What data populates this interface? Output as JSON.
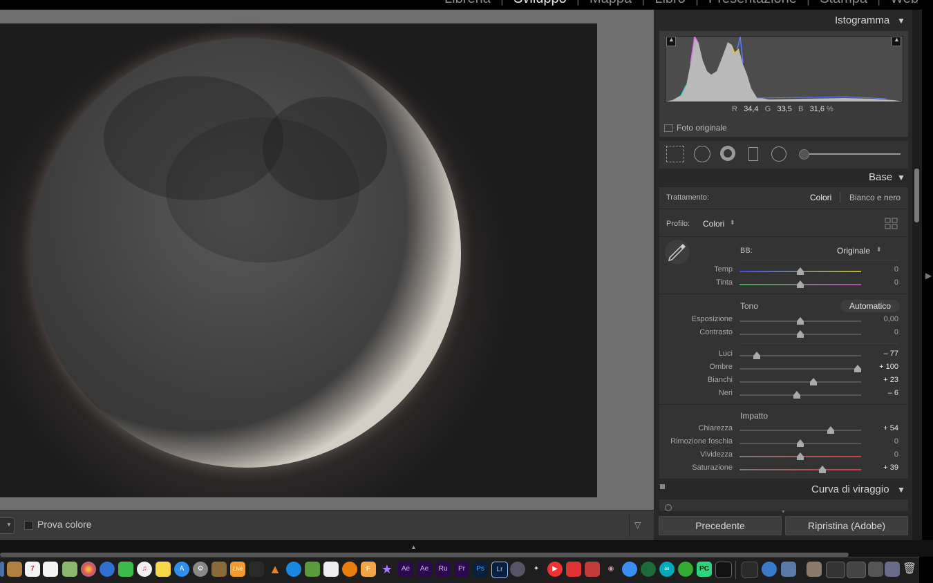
{
  "modules": {
    "libreria": "Libreria",
    "sviluppo": "Sviluppo",
    "mappa": "Mappa",
    "libro": "Libro",
    "presentazione": "Presentazione",
    "stampa": "Stampa",
    "web": "Web",
    "sep": "|"
  },
  "toolbar": {
    "proof_label": "Prova colore"
  },
  "histogram": {
    "title": "Istogramma",
    "r_label": "R",
    "r_value": "34,4",
    "g_label": "G",
    "g_value": "33,5",
    "b_label": "B",
    "b_value": "31,6",
    "percent": "%",
    "original_photo_label": "Foto originale"
  },
  "base": {
    "title": "Base",
    "treatment_label": "Trattamento:",
    "treatment_color": "Colori",
    "treatment_bw": "Bianco e nero",
    "profile_label": "Profilo:",
    "profile_value": "Colori",
    "wb_label": "BB:",
    "wb_value": "Originale",
    "tone_label": "Tono",
    "auto_label": "Automatico",
    "impact_label": "Impatto",
    "sliders": [
      {
        "label": "Temp",
        "value": "0",
        "position": 0.5
      },
      {
        "label": "Tinta",
        "value": "0",
        "position": 0.5
      },
      {
        "label": "Esposizione",
        "value": "0,00",
        "position": 0.5
      },
      {
        "label": "Contrasto",
        "value": "0",
        "position": 0.5
      },
      {
        "label": "Luci",
        "value": "– 77",
        "position": 0.14
      },
      {
        "label": "Ombre",
        "value": "+ 100",
        "position": 0.97
      },
      {
        "label": "Bianchi",
        "value": "+ 23",
        "position": 0.61
      },
      {
        "label": "Neri",
        "value": "– 6",
        "position": 0.47
      },
      {
        "label": "Chiarezza",
        "value": "+ 54",
        "position": 0.75
      },
      {
        "label": "Rimozione foschia",
        "value": "0",
        "position": 0.5
      },
      {
        "label": "Vividezza",
        "value": "0",
        "position": 0.5
      },
      {
        "label": "Saturazione",
        "value": "+ 39",
        "position": 0.68
      }
    ]
  },
  "tone_curve": {
    "title": "Curva di viraggio"
  },
  "buttons": {
    "previous": "Precedente",
    "reset": "Ripristina (Adobe)"
  },
  "dock": {
    "calendar_day": "7",
    "live_label": "Live",
    "ae1": "Ae",
    "ae2": "Ae",
    "ru": "Ru",
    "pr": "Pr",
    "ps": "Ps",
    "lr": "Lr",
    "pc": "PC",
    "f": "F"
  },
  "colors": {
    "accent_highlight": "#e8e8e8",
    "panel_bg": "#282828",
    "section_bg": "#333333"
  }
}
